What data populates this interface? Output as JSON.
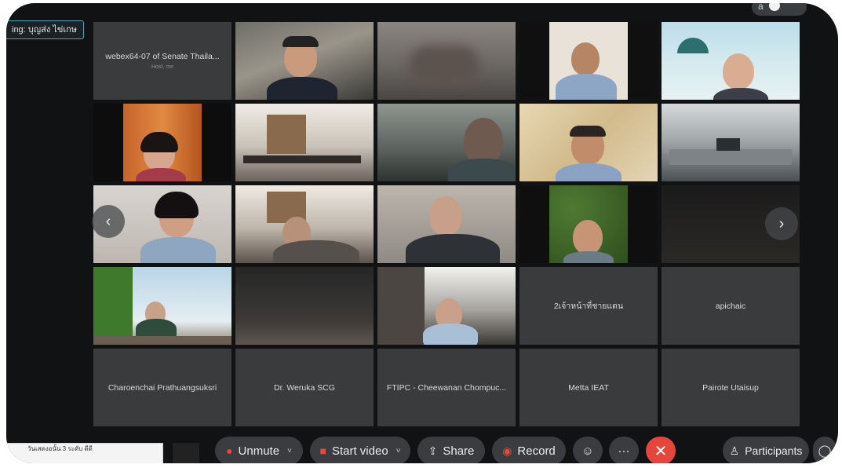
{
  "speaking_label": "ing: บุญส่ง ไข่เกษ",
  "top_right": {
    "letter": "a"
  },
  "tiles": {
    "self_name": "webex64-07 of  Senate Thaila...",
    "self_sub": "Host, me",
    "p_row4_col4": "2เจ้าหน้าที่ชายแดน",
    "p_row4_col5": "apichaic",
    "p_row5_col1": "Charoenchai Prathuangsuksri",
    "p_row5_col2": "Dr. Weruka SCG",
    "p_row5_col3": "FTIPC - Cheewanan Chompuc...",
    "p_row5_col4": "Metta IEAT",
    "p_row5_col5": "Pairote Utaisup"
  },
  "nav": {
    "prev": "‹",
    "next": "›"
  },
  "toolbar": {
    "chat_text": "วันเสดงอนั้น 3 ระดับ ดีดี",
    "unmute": "Unmute",
    "start_video": "Start video",
    "share": "Share",
    "record": "Record",
    "more": "···",
    "leave": "✕",
    "participants": "Participants"
  },
  "colors": {
    "accent": "#4aa7b8",
    "leave": "#e5453a",
    "tile_bg": "#3a3b3d",
    "frame_bg": "#101214"
  }
}
